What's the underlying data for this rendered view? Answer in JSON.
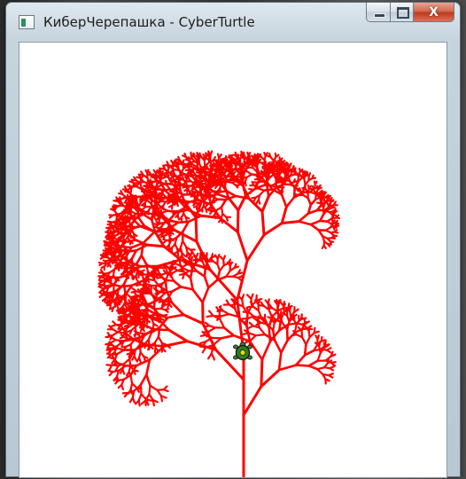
{
  "window": {
    "title": "КиберЧерепашка - CyberTurtle",
    "icon": "app-icon",
    "buttons": {
      "minimize_icon": "minimize-icon",
      "maximize_icon": "maximize-icon",
      "close_icon": "close-icon",
      "close_glyph": "X"
    }
  },
  "canvas": {
    "background": "#ffffff",
    "drawing": "fractal-tree",
    "stroke_color": "#ff0000",
    "turtle": {
      "icon": "turtle-icon",
      "shell_color": "#2e7d1e",
      "outline_color": "#1a1a1a"
    }
  }
}
